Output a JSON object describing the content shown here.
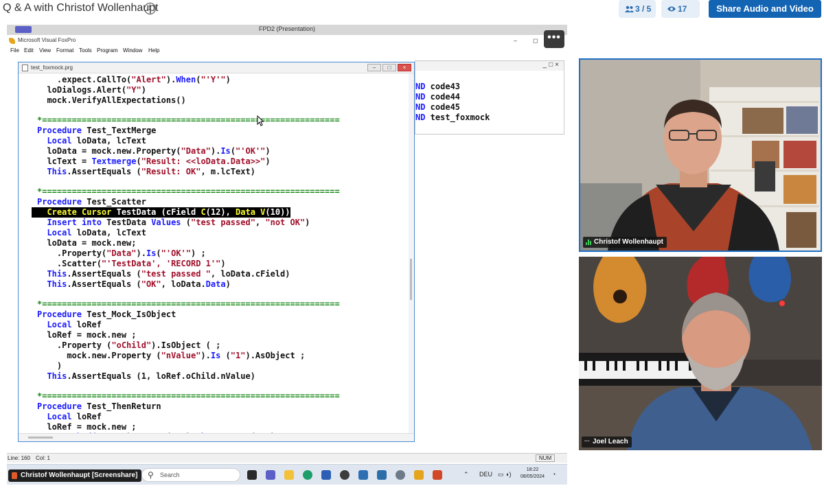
{
  "meeting": {
    "title": "Q & A with Christof Wollenhaupt",
    "participants_count": "3 / 5",
    "viewers_count": "17",
    "share_button_label": "Share Audio and Video"
  },
  "screenshare": {
    "window_title": "FPD2 (Presentation)",
    "app_title": "Microsoft Visual FoxPro",
    "menu": [
      "File",
      "Edit",
      "View",
      "Format",
      "Tools",
      "Program",
      "Window",
      "Help"
    ],
    "presenter_label": "Christof Wollenhaupt [Screenshare]",
    "editor": {
      "filename": "test_foxmock.prg"
    },
    "output_window": {
      "lines": [
        {
          "kw": "ND",
          "text": " code43"
        },
        {
          "kw": "ND",
          "text": " code44"
        },
        {
          "kw": "ND",
          "text": " code45"
        },
        {
          "kw": "ND",
          "text": " test_foxmock"
        }
      ]
    },
    "status_bar": {
      "line": "Line: 160",
      "col": "Col: 1",
      "num": "NUM"
    },
    "taskbar": {
      "search_placeholder": "Search",
      "language": "DEU",
      "time": "18:22",
      "date": "08/05/2024"
    }
  },
  "participants": [
    {
      "name": "Christof Wollenhaupt"
    },
    {
      "name": "Joel Leach"
    }
  ]
}
